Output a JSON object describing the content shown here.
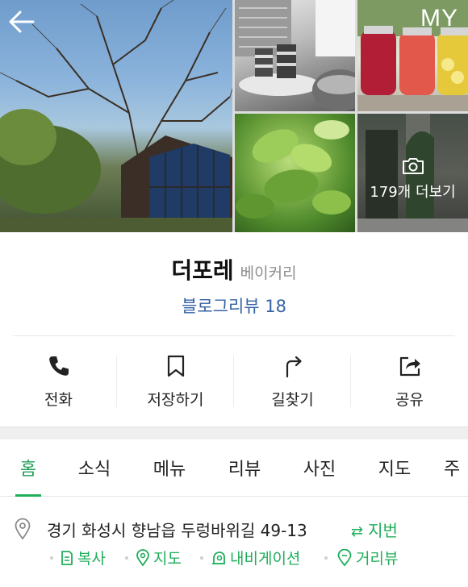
{
  "header": {
    "my_label": "MY"
  },
  "gallery": {
    "more_label": "179개 더보기"
  },
  "place": {
    "name": "더포레",
    "category": "베이커리",
    "review_link": "블로그리뷰 18"
  },
  "actions": [
    {
      "label": "전화",
      "icon": "phone-icon"
    },
    {
      "label": "저장하기",
      "icon": "bookmark-icon"
    },
    {
      "label": "길찾기",
      "icon": "directions-icon"
    },
    {
      "label": "공유",
      "icon": "share-icon"
    }
  ],
  "tabs": [
    {
      "label": "홈",
      "active": true
    },
    {
      "label": "소식"
    },
    {
      "label": "메뉴"
    },
    {
      "label": "리뷰"
    },
    {
      "label": "사진"
    },
    {
      "label": "지도"
    },
    {
      "label": "주"
    }
  ],
  "address": {
    "road": "경기 화성시 향남읍 두렁바위길 49-13",
    "jibun_label": "지번",
    "copy_label": "복사",
    "map_label": "지도",
    "navigation_label": "내비게이션",
    "street_view_label": "거리뷰"
  },
  "colors": {
    "accent_green": "#1fae5a",
    "link_blue": "#3563a5"
  }
}
